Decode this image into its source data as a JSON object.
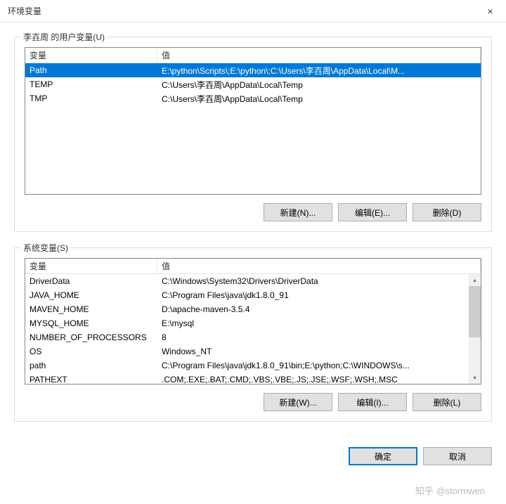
{
  "window": {
    "title": "环境变量",
    "close_label": "×"
  },
  "user_section": {
    "label": "李壵周 的用户变量(U)",
    "columns": {
      "var": "变量",
      "val": "值"
    },
    "rows": [
      {
        "var": "Path",
        "val": "E:\\python\\Scripts\\;E:\\python\\;C:\\Users\\李壵周\\AppData\\Local\\M..."
      },
      {
        "var": "TEMP",
        "val": "C:\\Users\\李壵周\\AppData\\Local\\Temp"
      },
      {
        "var": "TMP",
        "val": "C:\\Users\\李壵周\\AppData\\Local\\Temp"
      }
    ],
    "selected_index": 0,
    "buttons": {
      "new": "新建(N)...",
      "edit": "编辑(E)...",
      "delete": "删除(D)"
    }
  },
  "system_section": {
    "label": "系统变量(S)",
    "columns": {
      "var": "变量",
      "val": "值"
    },
    "rows": [
      {
        "var": "DriverData",
        "val": "C:\\Windows\\System32\\Drivers\\DriverData"
      },
      {
        "var": "JAVA_HOME",
        "val": "C:\\Program Files\\java\\jdk1.8.0_91"
      },
      {
        "var": "MAVEN_HOME",
        "val": "D:\\apache-maven-3.5.4"
      },
      {
        "var": "MYSQL_HOME",
        "val": "E:\\mysql"
      },
      {
        "var": "NUMBER_OF_PROCESSORS",
        "val": "8"
      },
      {
        "var": "OS",
        "val": "Windows_NT"
      },
      {
        "var": "path",
        "val": "C:\\Program Files\\java\\jdk1.8.0_91\\bin;E:\\python;C:\\WINDOWS\\s..."
      },
      {
        "var": "PATHEXT",
        "val": ".COM;.EXE;.BAT;.CMD;.VBS;.VBE;.JS;.JSE;.WSF;.WSH;.MSC"
      }
    ],
    "buttons": {
      "new": "新建(W)...",
      "edit": "编辑(I)...",
      "delete": "删除(L)"
    }
  },
  "dialog_buttons": {
    "ok": "确定",
    "cancel": "取消"
  },
  "watermark": "知乎 @stormwen"
}
